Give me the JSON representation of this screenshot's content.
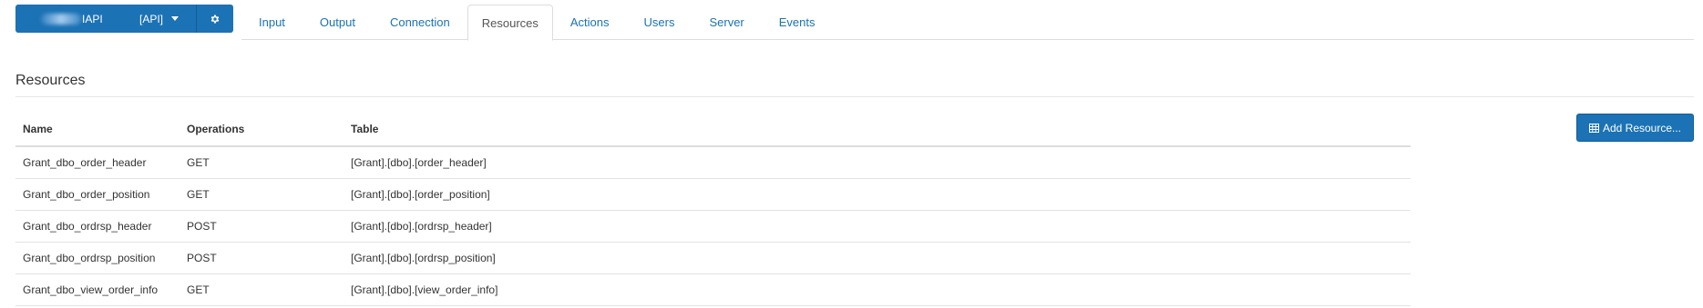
{
  "header": {
    "api_button": {
      "name_suffix": "IAPI",
      "tag": "[API]"
    },
    "gear_icon": "gear-icon",
    "tabs": [
      {
        "label": "Input",
        "active": false
      },
      {
        "label": "Output",
        "active": false
      },
      {
        "label": "Connection",
        "active": false
      },
      {
        "label": "Resources",
        "active": true
      },
      {
        "label": "Actions",
        "active": false
      },
      {
        "label": "Users",
        "active": false
      },
      {
        "label": "Server",
        "active": false
      },
      {
        "label": "Events",
        "active": false
      }
    ]
  },
  "main": {
    "title": "Resources",
    "add_button": {
      "label": "Add Resource...",
      "icon": "table-icon"
    },
    "table": {
      "columns": [
        "Name",
        "Operations",
        "Table"
      ],
      "rows": [
        {
          "name": "Grant_dbo_order_header",
          "operations": "GET",
          "table": "[Grant].[dbo].[order_header]"
        },
        {
          "name": "Grant_dbo_order_position",
          "operations": "GET",
          "table": "[Grant].[dbo].[order_position]"
        },
        {
          "name": "Grant_dbo_ordrsp_header",
          "operations": "POST",
          "table": "[Grant].[dbo].[ordrsp_header]"
        },
        {
          "name": "Grant_dbo_ordrsp_position",
          "operations": "POST",
          "table": "[Grant].[dbo].[ordrsp_position]"
        },
        {
          "name": "Grant_dbo_view_order_info",
          "operations": "GET",
          "table": "[Grant].[dbo].[view_order_info]"
        }
      ]
    }
  },
  "colors": {
    "accent": "#1b72b5",
    "border": "#dddddd",
    "text": "#333333"
  }
}
